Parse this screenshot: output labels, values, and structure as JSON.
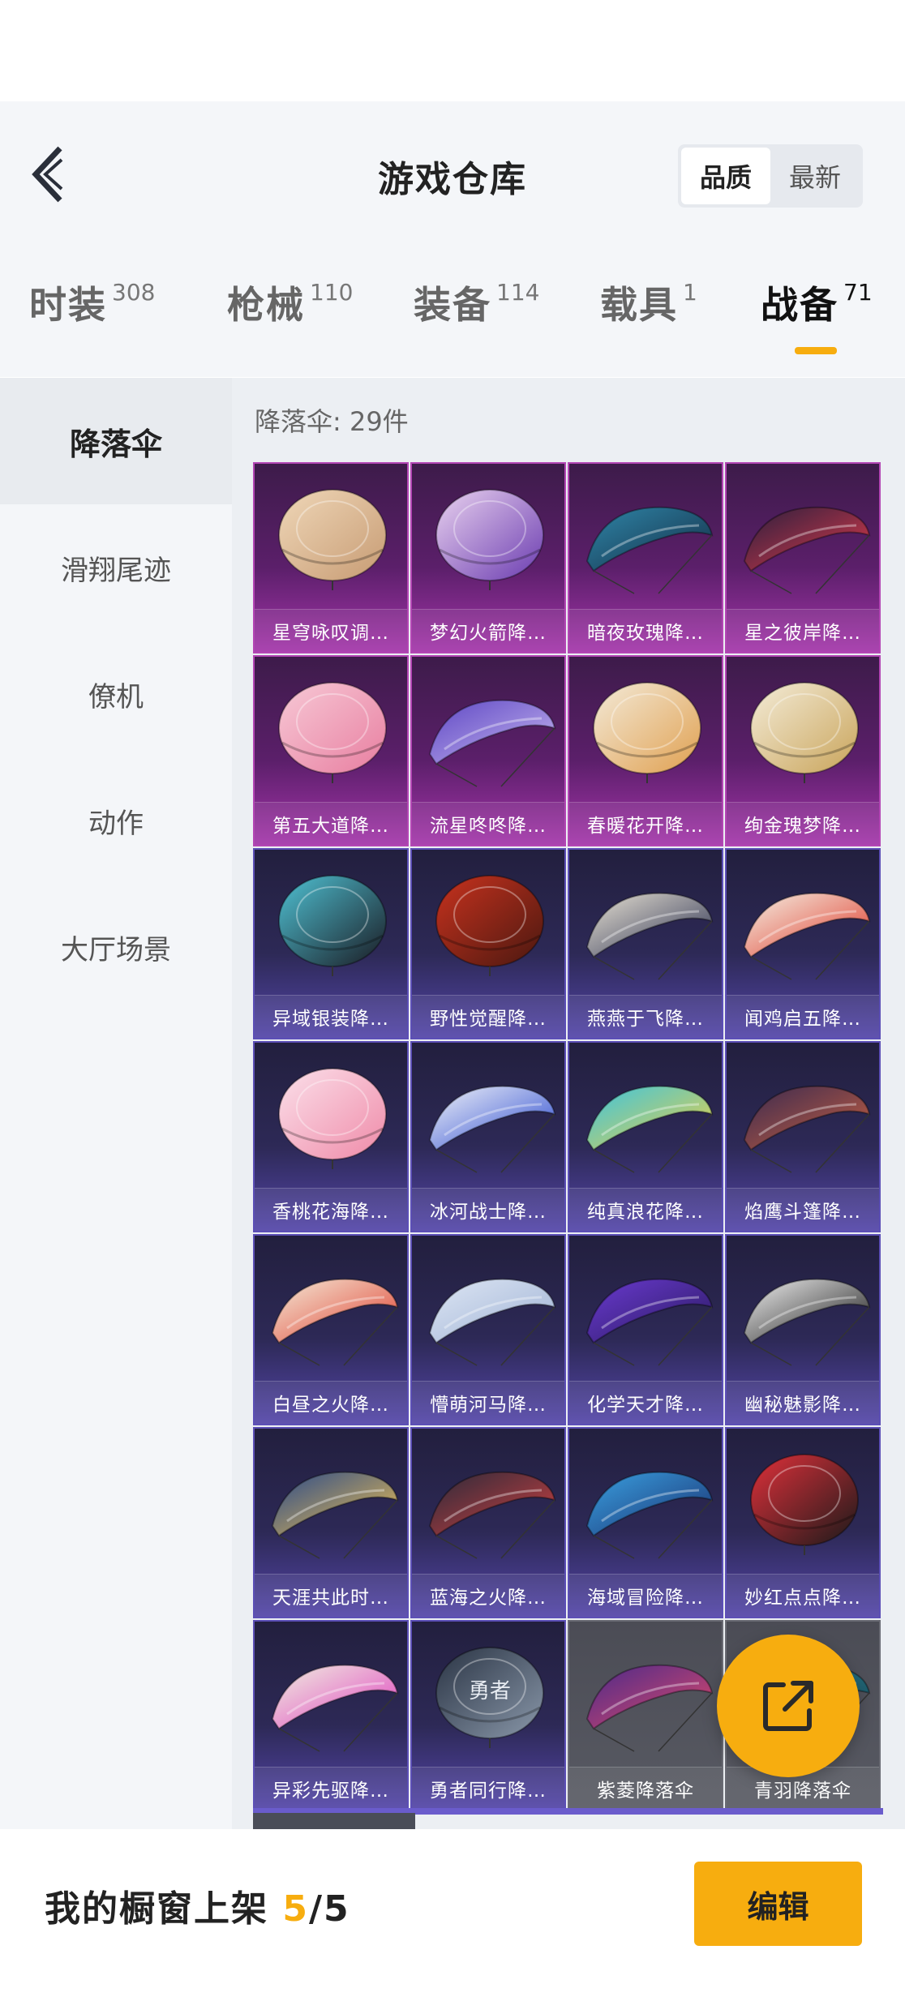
{
  "header": {
    "title": "游戏仓库",
    "sort_options": [
      "品质",
      "最新"
    ],
    "sort_selected": "品质"
  },
  "tabs": [
    {
      "label": "时装",
      "count": "308"
    },
    {
      "label": "枪械",
      "count": "110"
    },
    {
      "label": "装备",
      "count": "114"
    },
    {
      "label": "载具",
      "count": "1"
    },
    {
      "label": "战备",
      "count": "71",
      "active": true
    }
  ],
  "sidebar": {
    "items": [
      {
        "label": "降落伞",
        "active": true
      },
      {
        "label": "滑翔尾迹"
      },
      {
        "label": "僚机"
      },
      {
        "label": "动作"
      },
      {
        "label": "大厅场景"
      }
    ]
  },
  "list": {
    "count_label": "降落伞: 29件",
    "items": [
      {
        "name": "星穹咏叹调…",
        "rarity": "pink",
        "art": "round",
        "c1": "#efd7b8",
        "c2": "#c79b73"
      },
      {
        "name": "梦幻火箭降…",
        "rarity": "pink",
        "art": "round",
        "c1": "#e9d2ef",
        "c2": "#6a3bb0"
      },
      {
        "name": "暗夜玫瑰降…",
        "rarity": "pink",
        "art": "wing",
        "c1": "#2f86a8",
        "c2": "#142c44"
      },
      {
        "name": "星之彼岸降…",
        "rarity": "pink",
        "art": "wing",
        "c1": "#2a1f3e",
        "c2": "#e03a4a"
      },
      {
        "name": "第五大道降…",
        "rarity": "pink",
        "art": "round",
        "c1": "#f7c9d6",
        "c2": "#e87ea0"
      },
      {
        "name": "流星咚咚降…",
        "rarity": "pink",
        "art": "wing",
        "c1": "#5e47c4",
        "c2": "#c7b8f0"
      },
      {
        "name": "春暖花开降…",
        "rarity": "pink",
        "art": "round",
        "c1": "#f3ead8",
        "c2": "#e0a050"
      },
      {
        "name": "绚金瑰梦降…",
        "rarity": "pink",
        "art": "round",
        "c1": "#f4ecd8",
        "c2": "#c9a45a"
      },
      {
        "name": "异域银装降…",
        "rarity": "purple",
        "art": "round",
        "c1": "#4fc2d4",
        "c2": "#1a1a22"
      },
      {
        "name": "野性觉醒降…",
        "rarity": "purple",
        "art": "round",
        "c1": "#c8321e",
        "c2": "#4a1810"
      },
      {
        "name": "燕燕于飞降…",
        "rarity": "purple",
        "art": "wing",
        "c1": "#e8e2d4",
        "c2": "#2a3050"
      },
      {
        "name": "闻鸡启五降…",
        "rarity": "purple",
        "art": "wing",
        "c1": "#f4f0e4",
        "c2": "#e03a2a"
      },
      {
        "name": "香桃花海降…",
        "rarity": "purple",
        "art": "round",
        "c1": "#fbe0ea",
        "c2": "#ef8aa8"
      },
      {
        "name": "冰河战士降…",
        "rarity": "purple",
        "art": "wing",
        "c1": "#f0f2f8",
        "c2": "#2a4ad0"
      },
      {
        "name": "纯真浪花降…",
        "rarity": "purple",
        "art": "wing",
        "c1": "#3cc4e0",
        "c2": "#f0d040"
      },
      {
        "name": "焰鹰斗篷降…",
        "rarity": "purple",
        "art": "wing",
        "c1": "#3a2a50",
        "c2": "#c86040"
      },
      {
        "name": "白昼之火降…",
        "rarity": "purple",
        "art": "wing",
        "c1": "#f4ead8",
        "c2": "#e04030"
      },
      {
        "name": "懵萌河马降…",
        "rarity": "purple",
        "art": "wing",
        "c1": "#dde6f4",
        "c2": "#9fb2d4"
      },
      {
        "name": "化学天才降…",
        "rarity": "purple",
        "art": "wing",
        "c1": "#6a3ad0",
        "c2": "#2a1a60"
      },
      {
        "name": "幽秘魅影降…",
        "rarity": "purple",
        "art": "wing",
        "c1": "#f0f0f0",
        "c2": "#1a1a1a"
      },
      {
        "name": "天涯共此时…",
        "rarity": "purple",
        "art": "wing",
        "c1": "#2a4a8a",
        "c2": "#f0c050"
      },
      {
        "name": "蓝海之火降…",
        "rarity": "purple",
        "art": "wing",
        "c1": "#2a2a3a",
        "c2": "#d04040"
      },
      {
        "name": "海域冒险降…",
        "rarity": "purple",
        "art": "wing",
        "c1": "#3aa0e0",
        "c2": "#1a3070"
      },
      {
        "name": "妙红点点降…",
        "rarity": "purple",
        "art": "round",
        "c1": "#e0303a",
        "c2": "#1a1a1a"
      },
      {
        "name": "异彩先驱降…",
        "rarity": "purple",
        "art": "wing",
        "c1": "#f0f0e0",
        "c2": "#e040c0"
      },
      {
        "name": "勇者同行降…",
        "rarity": "purple",
        "art": "round",
        "c1": "#2a3444",
        "c2": "#8a98aa",
        "text": "勇者同行"
      },
      {
        "name": "紫菱降落伞",
        "rarity": "gray",
        "art": "wing",
        "c1": "#4a2a8a",
        "c2": "#e04a6a"
      },
      {
        "name": "青羽降落伞",
        "rarity": "gray",
        "art": "wing",
        "c1": "#2a8a9a",
        "c2": "#1a4a5a"
      }
    ]
  },
  "bottom_bar": {
    "showcase_label": "我的橱窗上架",
    "showcase_current": "5",
    "showcase_total": "/5",
    "edit_label": "编辑"
  },
  "colors": {
    "accent": "#f7ad0f",
    "rarity_pink": "#a334a9",
    "rarity_purple": "#5345a8",
    "rarity_gray": "#585a63"
  },
  "icons": {
    "back": "chevron-left-icon",
    "fab": "share-external-icon"
  }
}
